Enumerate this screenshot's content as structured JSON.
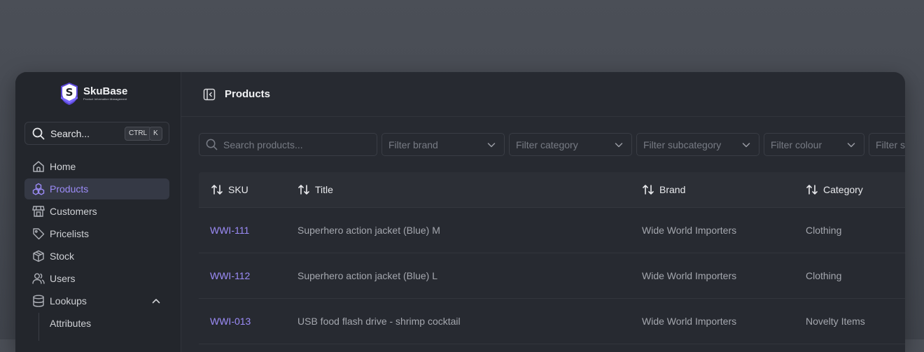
{
  "brand": {
    "name": "SkuBase",
    "tagline": "Product Information Management"
  },
  "sidebar": {
    "search": {
      "label": "Search...",
      "kbd_ctrl": "CTRL",
      "kbd_k": "K"
    },
    "items": [
      {
        "label": "Home",
        "icon": "home-icon"
      },
      {
        "label": "Products",
        "icon": "products-icon",
        "active": true
      },
      {
        "label": "Customers",
        "icon": "store-icon"
      },
      {
        "label": "Pricelists",
        "icon": "tag-icon"
      },
      {
        "label": "Stock",
        "icon": "box-icon"
      },
      {
        "label": "Users",
        "icon": "users-icon"
      },
      {
        "label": "Lookups",
        "icon": "database-icon",
        "expanded": true
      }
    ],
    "sub_items": [
      {
        "label": "Attributes"
      }
    ]
  },
  "header": {
    "title": "Products"
  },
  "filters": {
    "search_placeholder": "Search products...",
    "brand": "Filter brand",
    "category": "Filter category",
    "subcategory": "Filter subcategory",
    "colour": "Filter colour",
    "next": "Filter st"
  },
  "table": {
    "columns": [
      "SKU",
      "Title",
      "Brand",
      "Category"
    ],
    "rows": [
      {
        "sku": "WWI-111",
        "title": "Superhero action jacket (Blue) M",
        "brand": "Wide World Importers",
        "category": "Clothing"
      },
      {
        "sku": "WWI-112",
        "title": "Superhero action jacket (Blue) L",
        "brand": "Wide World Importers",
        "category": "Clothing"
      },
      {
        "sku": "WWI-013",
        "title": "USB food flash drive - shrimp cocktail",
        "brand": "Wide World Importers",
        "category": "Novelty Items"
      }
    ]
  },
  "colors": {
    "accent": "#9c8cf8",
    "background": "#272a31",
    "sidebar": "#23262c"
  }
}
